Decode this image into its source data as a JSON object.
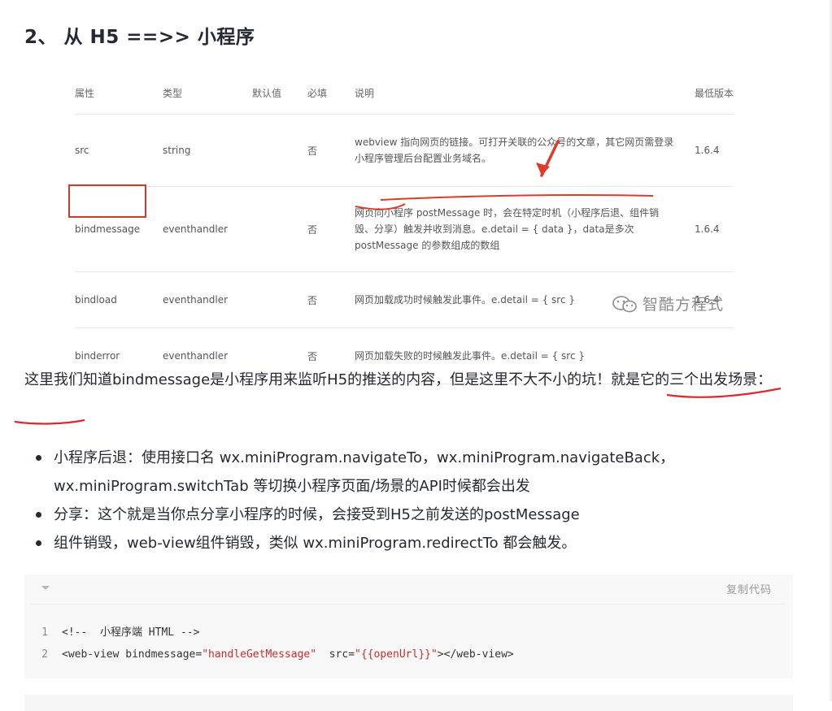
{
  "heading": "2、 从 H5 ==>> 小程序",
  "table": {
    "headers": [
      "属性",
      "类型",
      "默认值",
      "必填",
      "说明",
      "最低版本"
    ],
    "rows": [
      {
        "attr": "src",
        "type": "string",
        "default": "",
        "required": "否",
        "desc": [
          "webview 指向网页的链接。可打开关联的公众号的文章，其它网页需登录",
          "小程序管理后台配置业务域名。"
        ],
        "version": "1.6.4"
      },
      {
        "attr": "bindmessage",
        "type": "eventhandler",
        "default": "",
        "required": "否",
        "desc": [
          "网页向小程序 postMessage 时，会在特定时机（小程序后退、组件销",
          "毁、分享）触发并收到消息。e.detail = { data }，data是多次",
          "postMessage 的参数组成的数组"
        ],
        "version": "1.6.4"
      },
      {
        "attr": "bindload",
        "type": "eventhandler",
        "default": "",
        "required": "否",
        "desc": [
          "网页加载成功时候触发此事件。e.detail = { src }"
        ],
        "version": "1.6.4"
      },
      {
        "attr": "binderror",
        "type": "eventhandler",
        "default": "",
        "required": "否",
        "desc": [
          "网页加载失败的时候触发此事件。e.detail = { src }"
        ],
        "version": ""
      }
    ],
    "watermark": "智酷方程式",
    "annotation_color": "#e03a26"
  },
  "paragraph": "这里我们知道bindmessage是小程序用来监听H5的推送的内容，但是这里不大不小的坑！就是它的三个出发场景：",
  "bullets": [
    "小程序后退：使用接口名 wx.miniProgram.navigateTo，wx.miniProgram.navigateBack，wx.miniProgram.switchTab 等切换小程序页面/场景的API时候都会出发",
    "分享：这个就是当你点分享小程序的时候，会接受到H5之前发送的postMessage",
    "组件销毁，web-view组件销毁，类似 wx.miniProgram.redirectTo 都会触发。"
  ],
  "code": {
    "copy_label": "复制代码",
    "lines": [
      {
        "num": "1",
        "parts": [
          {
            "t": "<!--  小程序端 HTML -->",
            "k": "comment"
          }
        ]
      },
      {
        "num": "2",
        "parts": [
          {
            "t": "<web-view bindmessage=",
            "k": "plain"
          },
          {
            "t": "\"handleGetMessage\"",
            "k": "str"
          },
          {
            "t": "  src=",
            "k": "plain"
          },
          {
            "t": "\"{{openUrl}}\"",
            "k": "str"
          },
          {
            "t": "></web-view>",
            "k": "plain"
          }
        ]
      }
    ]
  }
}
